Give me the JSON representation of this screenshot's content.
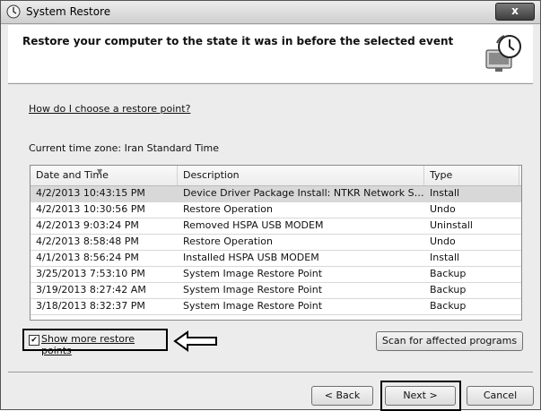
{
  "window": {
    "title": "System Restore",
    "close_label": "x"
  },
  "header": {
    "title": "Restore your computer to the state it was in before the selected event"
  },
  "howto_link": "How do I choose a restore point?",
  "timezone_text": "Current time zone: Iran Standard Time",
  "table": {
    "columns": [
      "Date and Time",
      "Description",
      "Type"
    ],
    "rows": [
      [
        "4/2/2013 10:43:15 PM",
        "Device Driver Package Install: NTKR Network Ser...",
        "Install"
      ],
      [
        "4/2/2013 10:30:56 PM",
        "Restore Operation",
        "Undo"
      ],
      [
        "4/2/2013 9:03:24 PM",
        "Removed HSPA USB MODEM",
        "Uninstall"
      ],
      [
        "4/2/2013 8:58:48 PM",
        "Restore Operation",
        "Undo"
      ],
      [
        "4/1/2013 8:56:24 PM",
        "Installed HSPA USB MODEM",
        "Install"
      ],
      [
        "3/25/2013 7:53:10 PM",
        "System Image Restore Point",
        "Backup"
      ],
      [
        "3/19/2013 8:27:42 AM",
        "System Image Restore Point",
        "Backup"
      ],
      [
        "3/18/2013 8:32:37 PM",
        "System Image Restore Point",
        "Backup"
      ]
    ]
  },
  "show_more": {
    "label": "Show more restore points",
    "checked": true
  },
  "buttons": {
    "scan": "Scan for affected programs",
    "back": "< Back",
    "next": "Next >",
    "cancel": "Cancel"
  }
}
